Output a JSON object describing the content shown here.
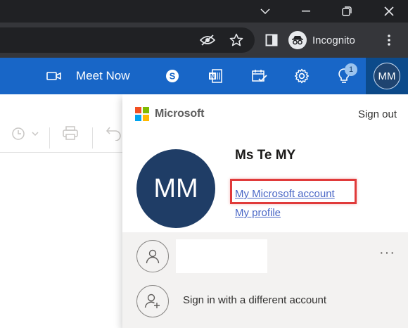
{
  "browser": {
    "incognito_label": "Incognito"
  },
  "header": {
    "meet_now_label": "Meet Now",
    "notification_count": "1",
    "me_initials": "MM"
  },
  "flyout": {
    "brand": "Microsoft",
    "sign_out_label": "Sign out",
    "avatar_initials": "MM",
    "user_name": "Ms Te MY",
    "my_account_link": "My Microsoft account",
    "my_profile_link": "My profile",
    "more_options": "···",
    "different_account_label": "Sign in with a different account"
  },
  "colors": {
    "header_blue": "#1866c7",
    "highlight_red": "#e03a3a",
    "link_blue": "#4a67c6"
  }
}
